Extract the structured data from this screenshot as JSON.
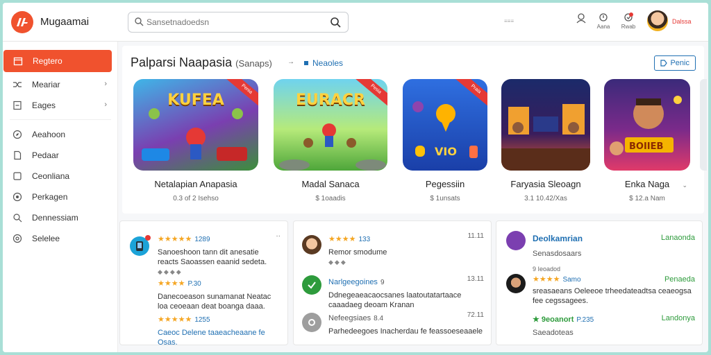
{
  "header": {
    "app_title": "Mugaamai",
    "search_placeholder": "Sansetnadoedsn",
    "misc_text": "≡≡≡",
    "actions": [
      {
        "icon": "user-icon",
        "label": ""
      },
      {
        "icon": "alert-icon",
        "label": "Aana"
      },
      {
        "icon": "notification-icon",
        "label": "Rwab"
      }
    ],
    "user_name": "Dalssa"
  },
  "sidebar": {
    "items": [
      {
        "label": "Regtero",
        "icon": "calendar-icon",
        "chevron": ""
      },
      {
        "label": "Meariar",
        "icon": "shuffle-icon",
        "chevron": "›"
      },
      {
        "label": "Eages",
        "icon": "file-icon",
        "chevron": "›"
      },
      {
        "label": "Aeahoon",
        "icon": "compass-icon",
        "chevron": ""
      },
      {
        "label": "Pedaar",
        "icon": "document-icon",
        "chevron": ""
      },
      {
        "label": "Ceonliana",
        "icon": "square-icon",
        "chevron": ""
      },
      {
        "label": "Perkagen",
        "icon": "target-icon",
        "chevron": ""
      },
      {
        "label": "Dennessiam",
        "icon": "search-icon",
        "chevron": ""
      },
      {
        "label": "Selelee",
        "icon": "at-icon",
        "chevron": ""
      }
    ]
  },
  "section": {
    "title": "Palparsi Naapasia",
    "subtitle": "(Sanaps)",
    "arrow": "→",
    "link": "Neaoles",
    "button": "Penic"
  },
  "games": [
    {
      "thumb_text": "KUFEA",
      "badge": "Penia",
      "name": "Netalapian Anapasia",
      "meta": "0.3 of 2 Isehso",
      "colors": [
        "#3fb6e8",
        "#7a3fb0"
      ]
    },
    {
      "thumb_text": "EURACR",
      "badge": "Pesia",
      "name": "Madal Sanaca",
      "meta": "$ 1oaadis",
      "colors": [
        "#6fd3ef",
        "#4ea63a"
      ]
    },
    {
      "thumb_text": "",
      "badge": "Praia",
      "name": "Pegessiin",
      "meta": "$ 1unsats",
      "colors": [
        "#2f6fe0",
        "#1a3fa8"
      ]
    },
    {
      "thumb_text": "",
      "badge": "",
      "name": "Faryasia Sleoagn",
      "meta": "3.1 10.42/Xas",
      "colors": [
        "#1b2a6a",
        "#e85a2a"
      ]
    },
    {
      "thumb_text": "BOIIEB",
      "badge": "",
      "name": "Enka Naga",
      "meta": "$ 12.a Nam",
      "colors": [
        "#3b2a7a",
        "#e03a6a"
      ]
    }
  ],
  "reviews": [
    {
      "rows": [
        {
          "stars": "★★★★★",
          "num": "1289",
          "side": "··",
          "text": "Sanoeshoon tann dit anesatie reacts Saoassen eaanid sedeta.",
          "icons": "◆◆◆◆"
        },
        {
          "stars": "★★★★",
          "num": "P.30",
          "side": "",
          "text": "Danecoeason sunamanat Neatac loa ceoeaan deat boanga daaa.",
          "icons": ""
        },
        {
          "stars": "★★★★★",
          "num": "1255",
          "side": "",
          "text": "Caeoc Delene taaeacheaane fe Osas.",
          "icons": ""
        }
      ]
    },
    {
      "rows": [
        {
          "stars": "★★★★",
          "num": "133",
          "side": "11.11",
          "text": "Remor smodume",
          "icons": "◆◆◆"
        },
        {
          "stars": "",
          "num": "9",
          "side": "13.11",
          "title": "Narlgeegoines",
          "text": "Ddnegeaeacaocsanes laatoutatartaace caaadaeg deoam Kranan",
          "icons": ""
        },
        {
          "stars": "",
          "num": "8.4",
          "side": "72.11",
          "title": "Nefeegsiaes",
          "text": "Parhedeegoes Inacherdau fe feassoeseaaele",
          "icons": ""
        }
      ]
    },
    {
      "rows": [
        {
          "title": "Deolkamrian",
          "text": "Senasdosaars",
          "side": "Lanaonda"
        },
        {
          "title": "9 Ieoadod",
          "stars": "★★★★",
          "num": "Samo",
          "text": "sreasaeans Oeleeoe trheedateadtsa ceaeogsa fee cegssagees.",
          "side": "Penaeda"
        },
        {
          "title": "9eoanort",
          "num": "P.235",
          "text": "Saeadoteas",
          "side": "Landonya"
        }
      ]
    }
  ],
  "colors": {
    "accent": "#f0522e",
    "link": "#1f6fb2",
    "star": "#f5a623",
    "green": "#2e9b3c"
  }
}
